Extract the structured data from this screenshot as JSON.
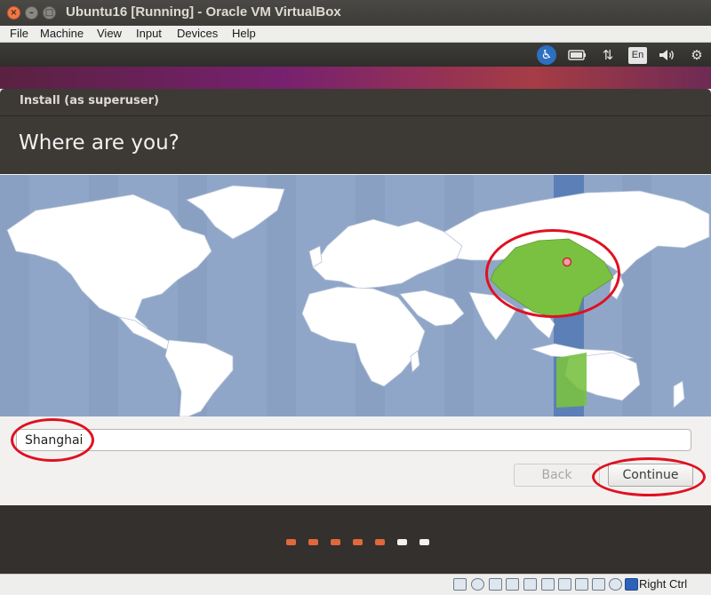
{
  "window": {
    "title": "Ubuntu16 [Running] - Oracle VM VirtualBox"
  },
  "menu": [
    "File",
    "Machine",
    "View",
    "Input",
    "Devices",
    "Help"
  ],
  "guest_panel": {
    "icons": [
      "accessibility-icon",
      "battery-icon",
      "network-icon",
      "keyboard-language-icon",
      "volume-icon",
      "settings-gear-icon"
    ],
    "language": "En"
  },
  "installer": {
    "window_title": "Install (as superuser)",
    "heading": "Where are you?",
    "location_value": "Shanghai",
    "back_label": "Back",
    "continue_label": "Continue",
    "selected_timezone_color": "#7ac142"
  },
  "progress": {
    "total_steps": 7,
    "completed_steps": 5,
    "done_color": "#e0683b",
    "pending_color": "#f2f1f0"
  },
  "status_bar": {
    "host_key": "Right Ctrl"
  },
  "annotation": {
    "color": "#e01020"
  }
}
